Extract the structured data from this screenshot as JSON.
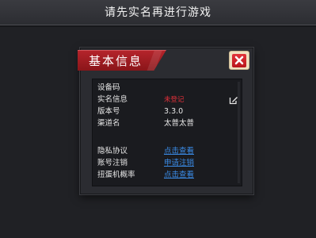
{
  "top_bar": {
    "title": "请先实名再进行游戏"
  },
  "dialog": {
    "title": "基本信息",
    "close_icon": "close-x-icon"
  },
  "info": {
    "device_code_label": "设备码",
    "device_code_value": "",
    "realname_label": "实名信息",
    "realname_value": "未登记",
    "version_label": "版本号",
    "version_value": "3.3.0",
    "channel_label": "渠道名",
    "channel_value": "太普太普",
    "privacy_label": "隐私协议",
    "privacy_value": "点击查看",
    "account_label": "账号注销",
    "account_value": "申请注销",
    "gacha_label": "扭蛋机概率",
    "gacha_value": "点击查看"
  },
  "colors": {
    "accent_red": "#b4242b",
    "link_blue": "#3a8be6",
    "warning_red": "#e8303a"
  }
}
